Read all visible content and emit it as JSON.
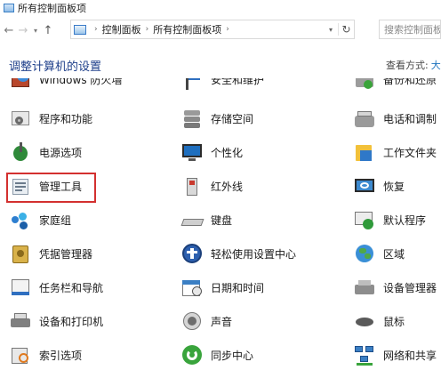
{
  "window": {
    "title": "所有控制面板项"
  },
  "nav": {
    "back_glyph": "←",
    "forward_glyph": "→",
    "dropdown_glyph": "▾",
    "up_glyph": "↑",
    "breadcrumb": [
      "控制面板",
      "所有控制面板项"
    ],
    "breadcrumb_sep": "›",
    "refresh_glyph": "↻",
    "search_placeholder": "搜索控制面板"
  },
  "header": {
    "title": "调整计算机的设置",
    "view_by_label": "查看方式:",
    "view_by_value": "大"
  },
  "items": [
    {
      "label": "Windows 防火墙",
      "icon": "firewall-icon"
    },
    {
      "label": "安全和维护",
      "icon": "flag-icon"
    },
    {
      "label": "备份和还原",
      "icon": "backup-icon"
    },
    {
      "label": "程序和功能",
      "icon": "programs-icon"
    },
    {
      "label": "存储空间",
      "icon": "storage-icon"
    },
    {
      "label": "电话和调制",
      "icon": "phone-modem-icon"
    },
    {
      "label": "电源选项",
      "icon": "power-options-icon"
    },
    {
      "label": "个性化",
      "icon": "personalization-icon"
    },
    {
      "label": "工作文件夹",
      "icon": "work-folders-icon"
    },
    {
      "label": "管理工具",
      "icon": "admin-tools-icon"
    },
    {
      "label": "红外线",
      "icon": "infrared-icon"
    },
    {
      "label": "恢复",
      "icon": "recovery-icon"
    },
    {
      "label": "家庭组",
      "icon": "homegroup-icon"
    },
    {
      "label": "键盘",
      "icon": "keyboard-icon"
    },
    {
      "label": "默认程序",
      "icon": "default-programs-icon"
    },
    {
      "label": "凭据管理器",
      "icon": "credential-manager-icon"
    },
    {
      "label": "轻松使用设置中心",
      "icon": "ease-of-access-icon"
    },
    {
      "label": "区域",
      "icon": "region-icon"
    },
    {
      "label": "任务栏和导航",
      "icon": "taskbar-icon"
    },
    {
      "label": "日期和时间",
      "icon": "date-time-icon"
    },
    {
      "label": "设备管理器",
      "icon": "device-manager-icon"
    },
    {
      "label": "设备和打印机",
      "icon": "devices-printers-icon"
    },
    {
      "label": "声音",
      "icon": "sound-icon"
    },
    {
      "label": "鼠标",
      "icon": "mouse-icon"
    },
    {
      "label": "索引选项",
      "icon": "indexing-icon"
    },
    {
      "label": "同步中心",
      "icon": "sync-center-icon"
    },
    {
      "label": "网络和共享",
      "icon": "network-sharing-icon"
    }
  ],
  "highlighted_item": "管理工具",
  "colors": {
    "heading": "#1e3f8a",
    "highlight_border": "#d3302f",
    "link": "#1e73be"
  }
}
